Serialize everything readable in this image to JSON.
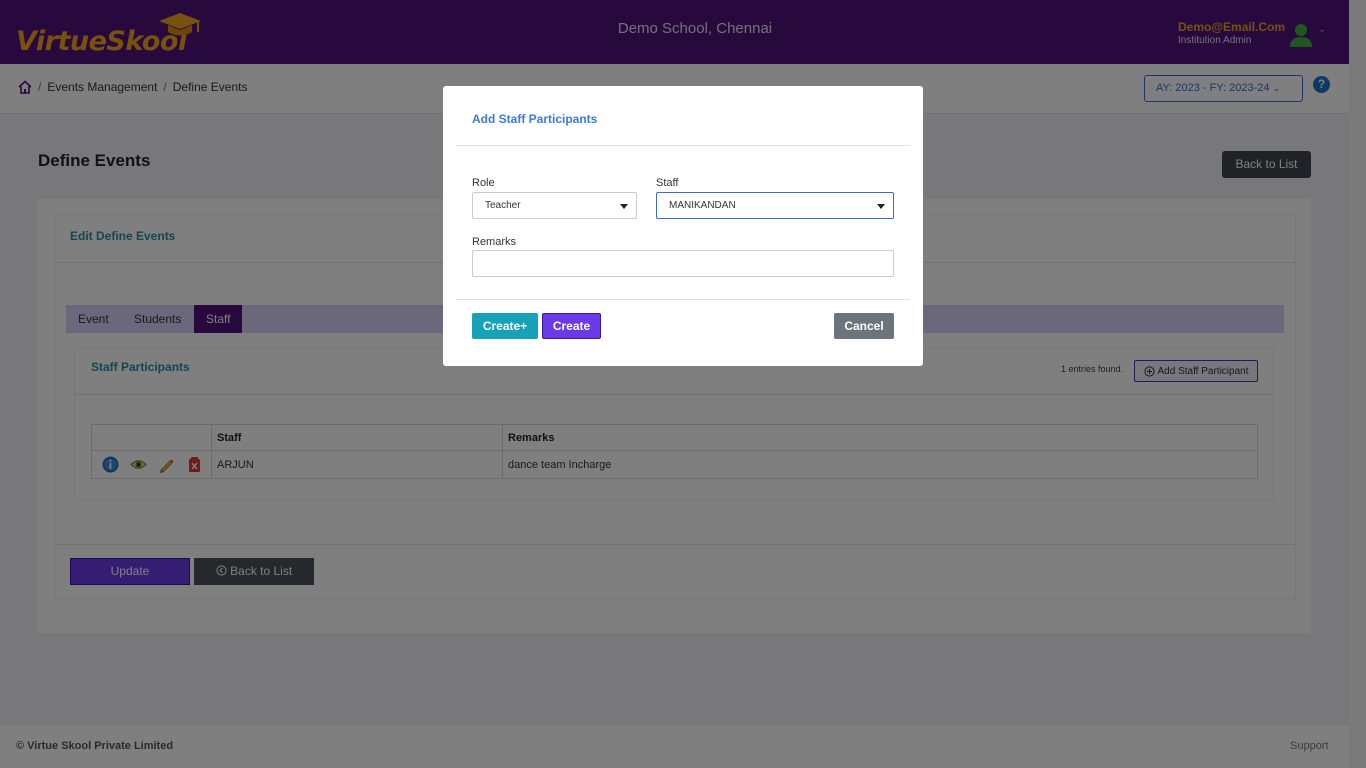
{
  "header": {
    "logo_text": "VirtueSkool",
    "school_name": "Demo School, Chennai",
    "user_email": "Demo@Email.Com",
    "user_role": "Institution Admin"
  },
  "breadcrumb": {
    "items": [
      "Events Management",
      "Define Events"
    ],
    "separator": "/"
  },
  "academic_year": "AY: 2023 - FY: 2023-24",
  "help_label": "?",
  "page": {
    "title": "Define Events",
    "back_to_list": "Back to List",
    "edit_title": "Edit Define Events",
    "tabs": [
      "Event",
      "Students",
      "Staff"
    ],
    "active_tab": "Staff"
  },
  "staff_participants": {
    "title": "Staff Participants",
    "entries_text": "1 entries found.",
    "add_button": "Add Staff Participant",
    "columns": [
      "",
      "Staff",
      "Remarks"
    ],
    "rows": [
      {
        "staff": "ARJUN",
        "remarks": "dance team Incharge"
      }
    ],
    "row_actions": [
      "info-icon",
      "view-icon",
      "edit-icon",
      "delete-icon"
    ]
  },
  "form_buttons": {
    "update": "Update",
    "back_to_list": "Back to List"
  },
  "footer": {
    "copyright": "© Virtue Skool Private Limited",
    "support": "Support"
  },
  "modal": {
    "title": "Add Staff Participants",
    "role_label": "Role",
    "role_value": "Teacher",
    "staff_label": "Staff",
    "staff_value": "MANIKANDAN",
    "remarks_label": "Remarks",
    "remarks_value": "",
    "create_plus": "Create+",
    "create": "Create",
    "cancel": "Cancel"
  },
  "colors": {
    "header_bg": "#51127a",
    "brand_orange": "#f0a21e",
    "accent_teal": "#2a8ba0",
    "primary_purple": "#6a3ae6",
    "info_teal": "#17a2b8"
  }
}
